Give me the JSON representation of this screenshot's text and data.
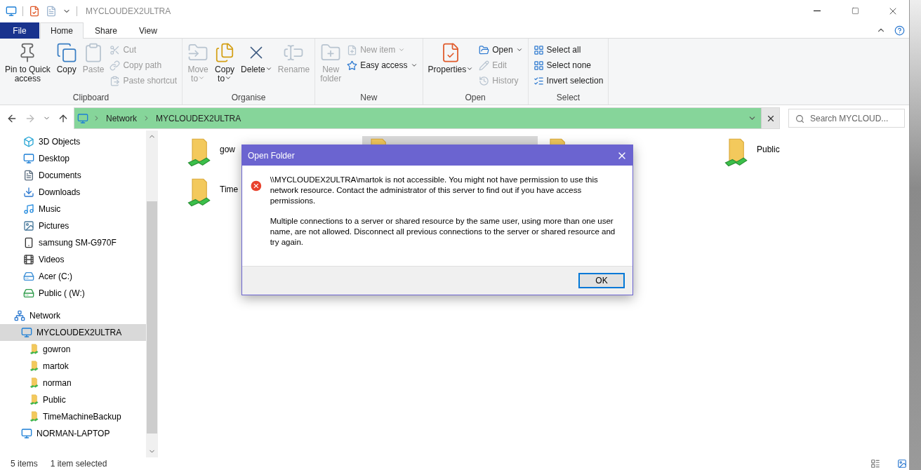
{
  "window": {
    "title": "MYCLOUDEX2ULTRA"
  },
  "ribbon_tabs": [
    {
      "label": "File",
      "kind": "file",
      "selected": false
    },
    {
      "label": "Home",
      "kind": "tab",
      "selected": true
    },
    {
      "label": "Share",
      "kind": "tab",
      "selected": false
    },
    {
      "label": "View",
      "kind": "tab",
      "selected": false
    }
  ],
  "ribbon": {
    "groups": [
      {
        "label": "Clipboard",
        "items": [
          {
            "kind": "large",
            "label": "Pin to Quick\naccess",
            "disabled": false,
            "dropdown": false
          },
          {
            "kind": "large",
            "label": "Copy",
            "disabled": false,
            "dropdown": false
          },
          {
            "kind": "large",
            "label": "Paste",
            "disabled": true,
            "dropdown": false
          },
          {
            "kind": "stack",
            "items": [
              {
                "label": "Cut",
                "disabled": true,
                "dropdown": false
              },
              {
                "label": "Copy path",
                "disabled": true,
                "dropdown": false
              },
              {
                "label": "Paste shortcut",
                "disabled": true,
                "dropdown": false
              }
            ]
          }
        ]
      },
      {
        "label": "Organise",
        "items": [
          {
            "kind": "large",
            "label": "Move\nto",
            "disabled": true,
            "dropdown": true
          },
          {
            "kind": "large",
            "label": "Copy\nto",
            "disabled": false,
            "dropdown": true
          },
          {
            "kind": "large",
            "label": "Delete",
            "disabled": false,
            "dropdown": true
          },
          {
            "kind": "large",
            "label": "Rename",
            "disabled": true,
            "dropdown": false
          }
        ]
      },
      {
        "label": "New",
        "items": [
          {
            "kind": "large",
            "label": "New\nfolder",
            "disabled": true,
            "dropdown": false
          },
          {
            "kind": "stack",
            "items": [
              {
                "label": "New item",
                "disabled": true,
                "dropdown": true
              },
              {
                "label": "Easy access",
                "disabled": false,
                "dropdown": true
              }
            ]
          }
        ]
      },
      {
        "label": "Open",
        "items": [
          {
            "kind": "large",
            "label": "Properties",
            "disabled": false,
            "dropdown": true
          },
          {
            "kind": "stack",
            "items": [
              {
                "label": "Open",
                "disabled": false,
                "dropdown": true
              },
              {
                "label": "Edit",
                "disabled": true,
                "dropdown": false
              },
              {
                "label": "History",
                "disabled": true,
                "dropdown": false
              }
            ]
          }
        ]
      },
      {
        "label": "Select",
        "items": [
          {
            "kind": "stack",
            "items": [
              {
                "label": "Select all",
                "disabled": false,
                "dropdown": false
              },
              {
                "label": "Select none",
                "disabled": false,
                "dropdown": false
              },
              {
                "label": "Invert selection",
                "disabled": false,
                "dropdown": false
              }
            ]
          }
        ]
      }
    ]
  },
  "address_bar": {
    "back_disabled": false,
    "forward_disabled": true,
    "breadcrumbs": [
      "Network",
      "MYCLOUDEX2ULTRA"
    ],
    "search_placeholder": "Search MYCLOUD..."
  },
  "nav_pane": {
    "quick_items": [
      {
        "label": "3D Objects"
      },
      {
        "label": "Desktop"
      },
      {
        "label": "Documents"
      },
      {
        "label": "Downloads"
      },
      {
        "label": "Music"
      },
      {
        "label": "Pictures"
      },
      {
        "label": "samsung SM-G970F"
      },
      {
        "label": "Videos"
      },
      {
        "label": "Acer (C:)"
      },
      {
        "label": "Public ( (W:)"
      }
    ],
    "tree": [
      {
        "label": "Network",
        "selected": false,
        "children": [
          {
            "label": "MYCLOUDEX2ULTRA",
            "selected": true,
            "children": [
              {
                "label": "gowron",
                "selected": false
              },
              {
                "label": "martok",
                "selected": false
              },
              {
                "label": "norman",
                "selected": false
              },
              {
                "label": "Public",
                "selected": false
              },
              {
                "label": "TimeMachineBackup",
                "selected": false
              }
            ]
          },
          {
            "label": "NORMAN-LAPTOP",
            "selected": false
          }
        ]
      }
    ]
  },
  "content": {
    "items": [
      {
        "label": "gow",
        "selected": false
      },
      {
        "selected": true
      },
      {
        "selected": false
      },
      {
        "label": "Public",
        "selected": false
      },
      {
        "label": "Time",
        "selected": false
      }
    ]
  },
  "dialog": {
    "title": "Open Folder",
    "paragraphs": [
      "\\\\MYCLOUDEX2ULTRA\\martok is not accessible. You might not have permission to use this network resource. Contact the administrator of this server to find out if you have access permissions.",
      "Multiple connections to a server or shared resource by the same user, using more than one user name, are not allowed. Disconnect all previous connections to the server or shared resource and try again."
    ],
    "button": "OK"
  },
  "status_bar": {
    "items": [
      "5 items",
      "1 item selected"
    ]
  }
}
